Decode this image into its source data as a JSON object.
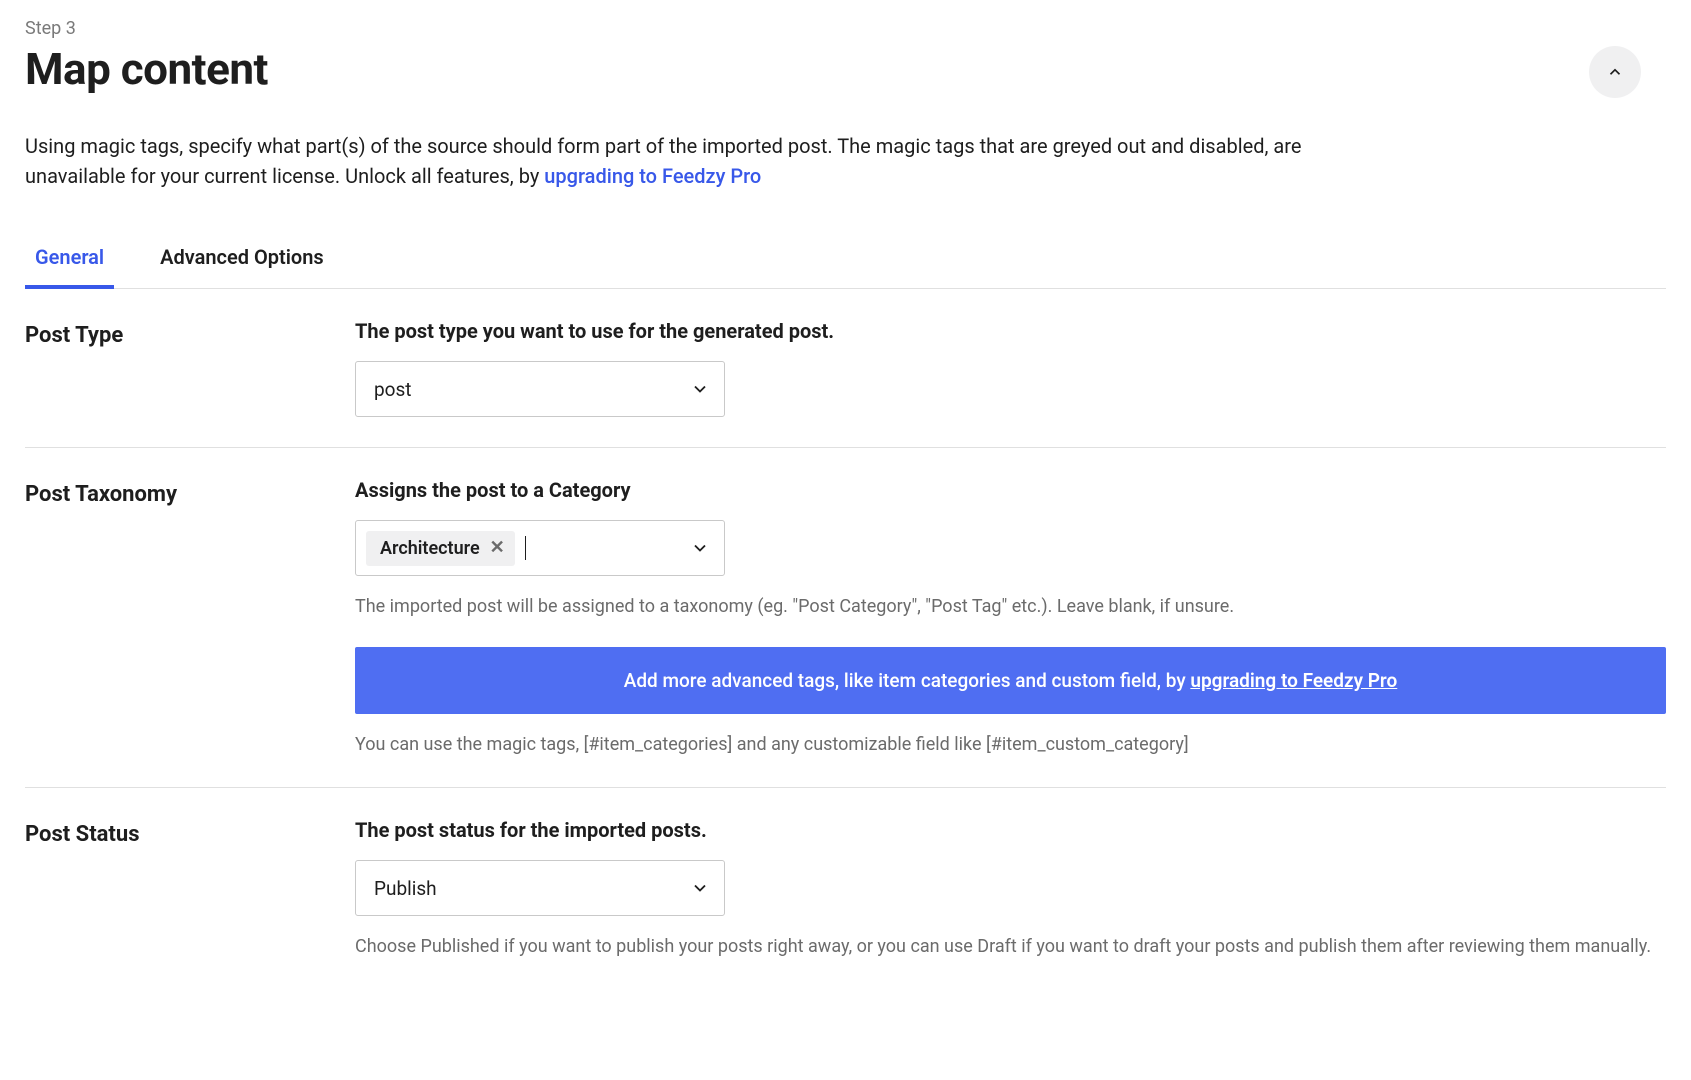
{
  "step_label": "Step 3",
  "heading": "Map content",
  "intro_text": "Using magic tags, specify what part(s) of the source should form part of the imported post. The magic tags that are greyed out and disabled, are unavailable for your current license. Unlock all features, by ",
  "intro_link": "upgrading to Feedzy Pro",
  "tabs": {
    "general": "General",
    "advanced": "Advanced Options"
  },
  "post_type": {
    "title": "Post Type",
    "label": "The post type you want to use for the generated post.",
    "value": "post"
  },
  "post_taxonomy": {
    "title": "Post Taxonomy",
    "label": "Assigns the post to a Category",
    "chip": "Architecture",
    "helper": "The imported post will be assigned to a taxonomy (eg. \"Post Category\", \"Post Tag\" etc.). Leave blank, if unsure.",
    "banner_text": "Add more advanced tags, like item categories and custom field, by ",
    "banner_link": "upgrading to Feedzy Pro",
    "helper2": "You can use the magic tags, [#item_categories] and any customizable field like [#item_custom_category]"
  },
  "post_status": {
    "title": "Post Status",
    "label": "The post status for the imported posts.",
    "value": "Publish",
    "helper": "Choose Published if you want to publish your posts right away, or you can use Draft if you want to draft your posts and publish them after reviewing them manually."
  }
}
